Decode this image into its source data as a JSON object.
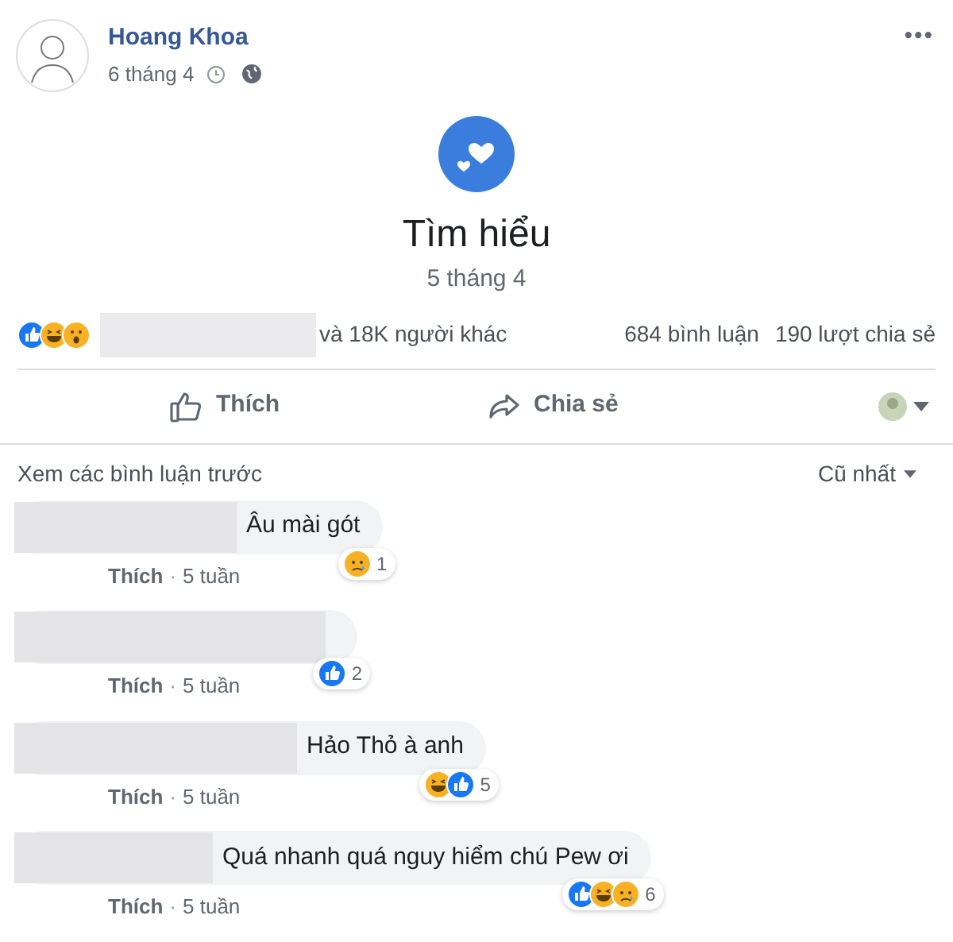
{
  "post": {
    "author": "Hoang Khoa",
    "date": "6 tháng 4",
    "more": "•••",
    "card_title": "Tìm hiểu",
    "card_date": "5 tháng 4"
  },
  "summary": {
    "reactions": [
      {
        "kind": "like"
      },
      {
        "kind": "haha"
      },
      {
        "kind": "wow"
      }
    ],
    "others": "và 18K người khác",
    "comments": "684 bình luận",
    "shares": "190 lượt chia sẻ"
  },
  "actions": [
    {
      "kind": "like",
      "label": "Thích"
    },
    {
      "kind": "share",
      "label": "Chia sẻ"
    }
  ],
  "comments_header": {
    "previous": "Xem các bình luận trước",
    "sort": "Cũ nhất"
  },
  "comments": [
    {
      "text": "Âu mài gót",
      "reactions": [
        {
          "kind": "sad"
        }
      ],
      "count": "1",
      "like": "Thích",
      "separator": "·",
      "time": "5 tuần"
    },
    {
      "reactions": [
        {
          "kind": "like"
        }
      ],
      "count": "2",
      "like": "Thích",
      "separator": "·",
      "time": "5 tuần"
    },
    {
      "text": "Hảo Thỏ à anh",
      "reactions": [
        {
          "kind": "haha"
        },
        {
          "kind": "like"
        }
      ],
      "count": "5",
      "like": "Thích",
      "separator": "·",
      "time": "5 tuần"
    },
    {
      "text": "Quá nhanh quá nguy hiểm chú Pew ơi",
      "reactions": [
        {
          "kind": "like"
        },
        {
          "kind": "haha"
        },
        {
          "kind": "sad"
        }
      ],
      "count": "6",
      "like": "Thích",
      "separator": "·",
      "time": "5 tuần"
    }
  ]
}
